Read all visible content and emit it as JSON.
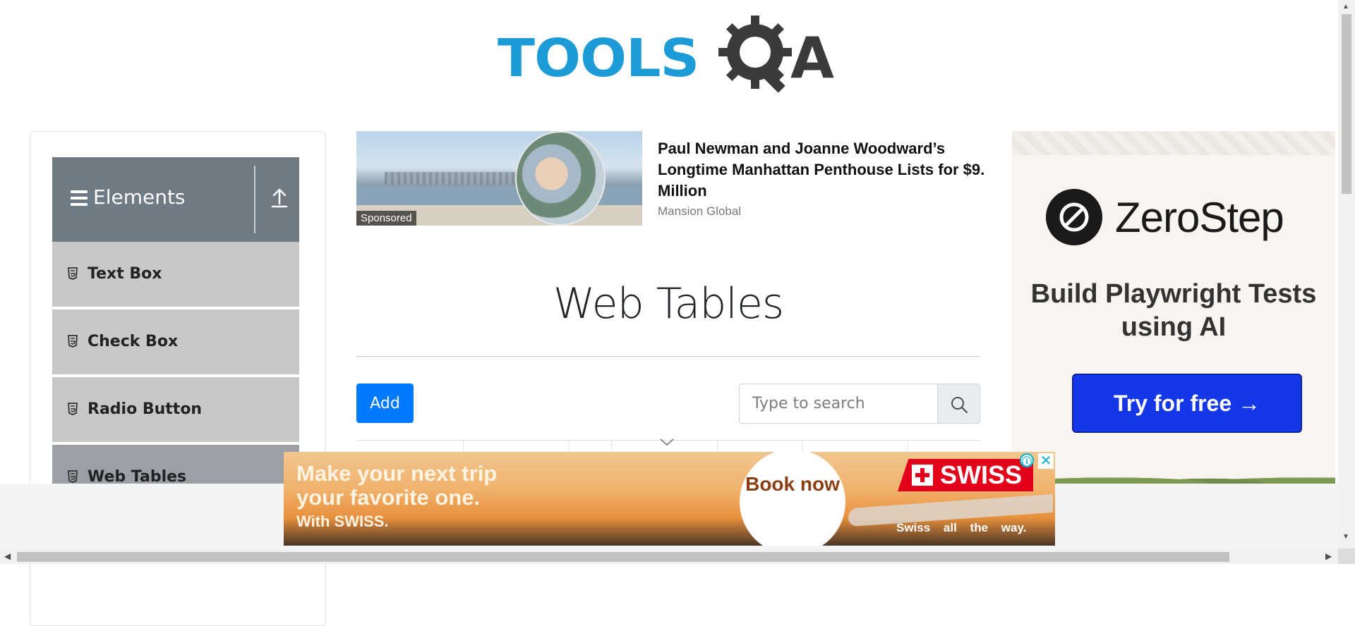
{
  "logo": {
    "text_left": "TOOLS",
    "text_right": "A",
    "alt": "TOOLSQA"
  },
  "sidebar": {
    "group_title": "Elements",
    "items": [
      {
        "label": "Text Box"
      },
      {
        "label": "Check Box"
      },
      {
        "label": "Radio Button"
      },
      {
        "label": "Web Tables",
        "active": true
      }
    ]
  },
  "ad_article": {
    "sponsored_label": "Sponsored",
    "headline": "Paul Newman and Joanne Woodward’s Longtime Manhattan Penthouse Lists for $9. Million",
    "source": "Mansion Global"
  },
  "main": {
    "title": "Web Tables",
    "add_label": "Add",
    "search_placeholder": "Type to search"
  },
  "right_ad": {
    "brand": "ZeroStep",
    "tagline": "Build Playwright Tests using AI",
    "cta": "Try for free →"
  },
  "banner": {
    "line1": "Make your next trip",
    "line2": "your favorite one.",
    "sub": "With SWISS.",
    "book": "Book now",
    "brand": "SWISS",
    "slogan": "Swiss all the way.",
    "info_icon": "ⓘ",
    "close_icon": "✕"
  },
  "colors": {
    "logo_blue": "#1d9bd6",
    "sidebar_header": "#6f7b84",
    "sidebar_item": "#c8c8c8",
    "primary_button": "#007bff",
    "cta_blue": "#1437e8",
    "swiss_red": "#e2001a"
  },
  "icons": {
    "hamburger": "hamburger-icon",
    "upload": "upload-icon",
    "menu_item": "html5-icon",
    "search": "search-icon",
    "sort": "chevron-down-icon"
  }
}
